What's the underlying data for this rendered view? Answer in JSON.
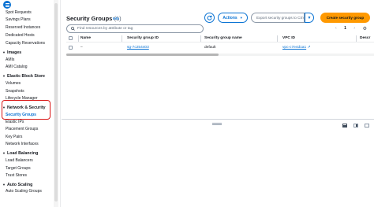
{
  "sidebar": {
    "top_items": [
      "Spot Requests",
      "Savings Plans",
      "Reserved Instances",
      "Dedicated Hosts",
      "Capacity Reservations"
    ],
    "sections": [
      {
        "title": "Images",
        "items": [
          "AMIs",
          "AMI Catalog"
        ]
      },
      {
        "title": "Elastic Block Store",
        "items": [
          "Volumes",
          "Snapshots",
          "Lifecycle Manager"
        ]
      },
      {
        "title": "Network & Security",
        "items": [
          "Security Groups",
          "Elastic IPs",
          "Placement Groups",
          "Key Pairs",
          "Network Interfaces"
        ]
      },
      {
        "title": "Load Balancing",
        "items": [
          "Load Balancers",
          "Target Groups",
          "Trust Stores"
        ]
      },
      {
        "title": "Auto Scaling",
        "items": [
          "Auto Scaling Groups"
        ]
      }
    ],
    "active_item": "Security Groups"
  },
  "header": {
    "title": "Security Groups",
    "count": "(1)",
    "info": "Info",
    "actions_label": "Actions",
    "export_label": "Export security groups to CSV",
    "create_label": "Create security group"
  },
  "search": {
    "placeholder": "Find resources by attribute or tag"
  },
  "pagination": {
    "page": "1"
  },
  "table": {
    "columns": [
      "Name",
      "Security group ID",
      "Security group name",
      "VPC ID",
      "Descr"
    ],
    "rows": [
      {
        "name": "–",
        "sg_id": "sg-7c254403",
        "sg_name": "default",
        "vpc_id": "vpc-c7e4d1a1"
      }
    ]
  },
  "colors": {
    "accent": "#0972d3",
    "primary_button": "#ff9900",
    "highlight": "#d91515"
  }
}
